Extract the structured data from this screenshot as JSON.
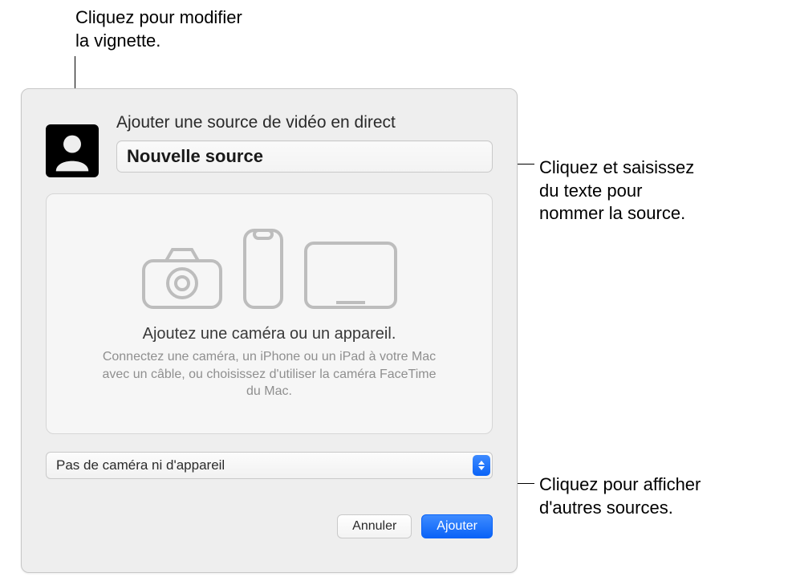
{
  "callouts": {
    "edit_thumbnail": "Cliquez pour modifier\nla vignette.",
    "name_source": "Cliquez et saisissez\ndu texte pour\nnommer la source.",
    "show_sources": "Cliquez pour afficher\nd'autres sources."
  },
  "dialog": {
    "title": "Ajouter une source de vidéo en direct",
    "source_name": "Nouvelle source",
    "preview_heading": "Ajoutez une caméra ou un appareil.",
    "preview_body": "Connectez une caméra, un iPhone ou un iPad à votre Mac avec un câble, ou choisissez d'utiliser la caméra FaceTime du Mac.",
    "dropdown_selected": "Pas de caméra ni d'appareil",
    "buttons": {
      "cancel": "Annuler",
      "add": "Ajouter"
    }
  }
}
